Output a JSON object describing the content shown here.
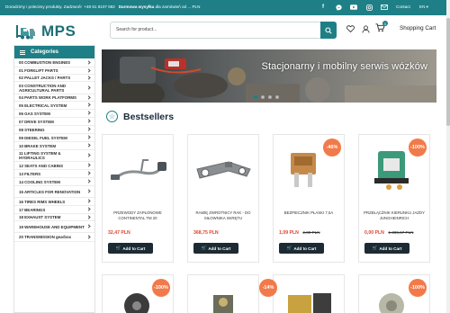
{
  "topbar": {
    "left_text": "Doradzimy i polecimy produkty. Zadzwoń!",
    "phone": "+48 61 8107 682",
    "shipping": "Darmowa wysyłka",
    "shipping_rest": "dla zamówień od ... PLN",
    "social_icons": [
      "facebook-icon",
      "messenger-icon",
      "youtube-icon",
      "instagram-icon",
      "mail-icon"
    ],
    "contact_label": "Contact",
    "lang_label": "EN"
  },
  "header": {
    "logo_text": "MPS",
    "search_placeholder": "Search for product...",
    "cart_label": "Shopping Cart",
    "cart_count": "0"
  },
  "sidebar": {
    "title": "Categories",
    "items": [
      "00 COMBUSTION ENGINES",
      "01 FORKLIFT PARTS",
      "02 PALLET JACKS / PARTS",
      "03 CONSTRUCTION AND AGRICULTURAL PARTS",
      "04 PARTS WORK PLATFORMS",
      "05 ELECTRICAL SYSTEM",
      "06 GAS SYSTEM",
      "07 DRIVE SYSTEM",
      "08 STEERING",
      "09 DIESEL FUEL SYSTEM",
      "10 BRAKE SYSTEM",
      "11 LIFTING SYSTEM & HYDRAULICS",
      "12 SEATS AND CABINS",
      "13 FILTERS",
      "14 COOLING SYSTEM",
      "15 ARTICLES FOR RENOVATION",
      "16 TIRES RIMS WHEELS",
      "17 BEARINGS",
      "18 EXHAUST SYSTEM",
      "19 WAREHOUSE AND EQUIPMENT",
      "20 TRANSMISSION gearbox"
    ]
  },
  "banner": {
    "title": "Stacjonarny i mobilny serwis wózków",
    "active_slide": 1,
    "slide_count": 4
  },
  "bestsellers": {
    "title": "Bestsellers",
    "products": [
      {
        "name": "PRZEWODY ZAPŁONOWE CONTINENTAL TM 20",
        "price": "32,47 PLN",
        "old_price": "",
        "discount": "",
        "button": "Add to Cart"
      },
      {
        "name": "RAMIĘ ZWROTNICY RAK - DO SIŁOWNIKA SKRĘTU",
        "price": "368,75 PLN",
        "old_price": "",
        "discount": "",
        "button": "Add to Cart"
      },
      {
        "name": "BEZPIECZNIK PŁASKI 7,5A",
        "price": "1,09 PLN",
        "old_price": "2,00 PLN",
        "discount": "-46%",
        "button": "Add to Cart"
      },
      {
        "name": "PRZEŁĄCZNIK KIERUNKU JAZDY JUNGHEINRICH",
        "price": "0,00 PLN",
        "old_price": "1 389,67 PLN",
        "discount": "-100%",
        "button": "Add to Cart"
      }
    ],
    "second_row_discounts": [
      "-100%",
      "",
      "-14%",
      "",
      "-100%"
    ]
  },
  "colors": {
    "brand": "#1f7f86",
    "discount": "#f27a4a",
    "price": "#d9452f",
    "button": "#1c2b33"
  }
}
